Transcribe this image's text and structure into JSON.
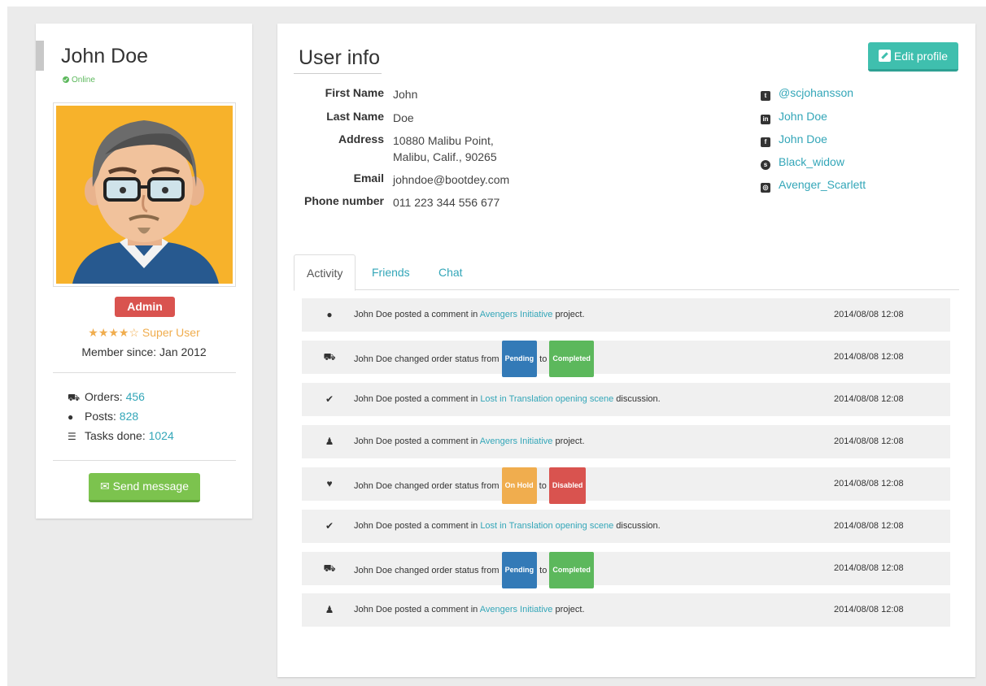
{
  "profile": {
    "name": "John Doe",
    "status": "Online",
    "role_badge": "Admin",
    "rating_stars": "★★★★☆",
    "rating_label": "Super User",
    "member_since": "Member since: Jan 2012",
    "stats": [
      {
        "label": "Orders: ",
        "value": "456",
        "icon": "truck-icon"
      },
      {
        "label": "Posts: ",
        "value": "828",
        "icon": "comment-icon"
      },
      {
        "label": "Tasks done: ",
        "value": "1024",
        "icon": "tasks-icon"
      }
    ],
    "send_message_label": "Send message"
  },
  "user_info": {
    "title": "User info",
    "edit_label": "Edit profile",
    "fields": [
      {
        "label": "First Name",
        "value": "John"
      },
      {
        "label": "Last Name",
        "value": "Doe"
      },
      {
        "label": "Address",
        "value": "10880 Malibu Point,",
        "value2": "Malibu, Calif., 90265"
      },
      {
        "label": "Email",
        "value": "johndoe@bootdey.com"
      },
      {
        "label": "Phone number",
        "value": "011 223 344 556 677"
      }
    ],
    "social": [
      {
        "icon": "twitter-icon",
        "text": "@scjohansson"
      },
      {
        "icon": "linkedin-icon",
        "text": "John Doe"
      },
      {
        "icon": "facebook-icon",
        "text": "John Doe"
      },
      {
        "icon": "skype-icon",
        "text": "Black_widow"
      },
      {
        "icon": "instagram-icon",
        "text": "Avenger_Scarlett"
      }
    ]
  },
  "tabs": [
    "Activity",
    "Friends",
    "Chat"
  ],
  "activity": [
    {
      "icon": "comment-icon",
      "pre": "John Doe posted a comment in ",
      "link": "Avengers Initiative",
      "post": " project.",
      "time": "2014/08/08 12:08"
    },
    {
      "icon": "truck-icon",
      "pre": "John Doe changed order status from ",
      "from": "Pending",
      "mid": " to ",
      "to": "Completed",
      "from_color": "#337ab7",
      "to_color": "#5cb85c",
      "time": "2014/08/08 12:08"
    },
    {
      "icon": "check-icon",
      "pre": "John Doe posted a comment in ",
      "link": "Lost in Translation opening scene",
      "post": " discussion.",
      "time": "2014/08/08 12:08"
    },
    {
      "icon": "users-icon",
      "pre": "John Doe posted a comment in ",
      "link": "Avengers Initiative",
      "post": " project.",
      "time": "2014/08/08 12:08"
    },
    {
      "icon": "heart-icon",
      "pre": "John Doe changed order status from ",
      "from": "On Hold",
      "mid": " to ",
      "to": "Disabled",
      "from_color": "#f0ad4e",
      "to_color": "#d9534f",
      "time": "2014/08/08 12:08"
    },
    {
      "icon": "check-icon",
      "pre": "John Doe posted a comment in ",
      "link": "Lost in Translation opening scene",
      "post": " discussion.",
      "time": "2014/08/08 12:08"
    },
    {
      "icon": "truck-icon",
      "pre": "John Doe changed order status from ",
      "from": "Pending",
      "mid": " to ",
      "to": "Completed",
      "from_color": "#337ab7",
      "to_color": "#5cb85c",
      "time": "2014/08/08 12:08"
    },
    {
      "icon": "users-icon",
      "pre": "John Doe posted a comment in ",
      "link": "Avengers Initiative",
      "post": " project.",
      "time": "2014/08/08 12:08"
    }
  ],
  "colors": {
    "accent": "#33a6b8",
    "danger": "#d9534f",
    "success": "#5cb85c",
    "warning": "#f0ad4e",
    "primary": "#337ab7"
  }
}
